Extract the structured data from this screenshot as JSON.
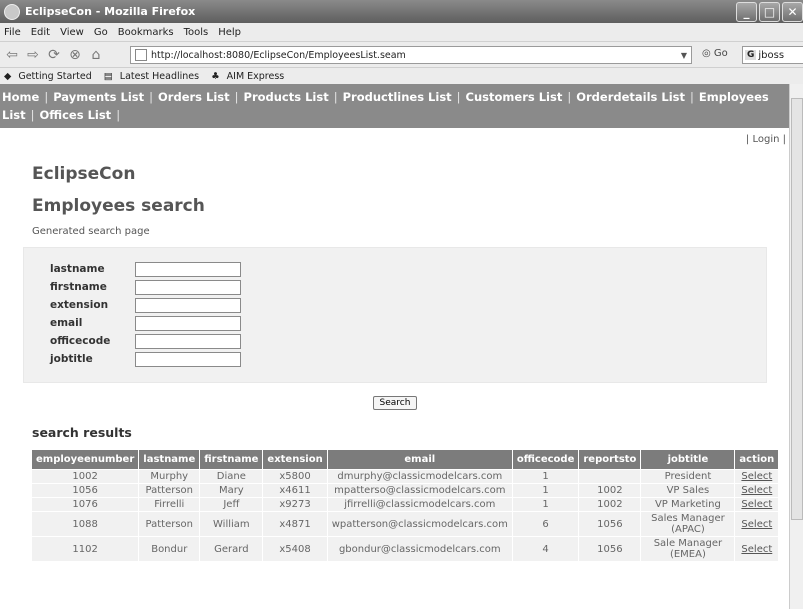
{
  "window": {
    "title": "EclipseCon - Mozilla Firefox"
  },
  "menubar": [
    "File",
    "Edit",
    "View",
    "Go",
    "Bookmarks",
    "Tools",
    "Help"
  ],
  "navbar": {
    "url": "http://localhost:8080/EclipseCon/EmployeesList.seam",
    "go_label": "Go",
    "search_value": "jboss",
    "search_engine": "G"
  },
  "bookmarks": [
    "Getting Started",
    "Latest Headlines",
    "AIM Express"
  ],
  "site_nav": [
    "Home",
    "Payments List",
    "Orders List",
    "Products List",
    "Productlines List",
    "Customers List",
    "Orderdetails List",
    "Employees List",
    "Offices List"
  ],
  "login_label": "Login",
  "page": {
    "app_title": "EclipseCon",
    "heading": "Employees search",
    "subtitle": "Generated search page",
    "fields": [
      "lastname",
      "firstname",
      "extension",
      "email",
      "officecode",
      "jobtitle"
    ],
    "search_button": "Search",
    "results_title": "search results"
  },
  "table": {
    "columns": [
      "employeenumber",
      "lastname",
      "firstname",
      "extension",
      "email",
      "officecode",
      "reportsto",
      "jobtitle",
      "action"
    ],
    "rows": [
      [
        "1002",
        "Murphy",
        "Diane",
        "x5800",
        "dmurphy@classicmodelcars.com",
        "1",
        "",
        "President",
        "Select"
      ],
      [
        "1056",
        "Patterson",
        "Mary",
        "x4611",
        "mpatterso@classicmodelcars.com",
        "1",
        "1002",
        "VP Sales",
        "Select"
      ],
      [
        "1076",
        "Firrelli",
        "Jeff",
        "x9273",
        "jfirrelli@classicmodelcars.com",
        "1",
        "1002",
        "VP Marketing",
        "Select"
      ],
      [
        "1088",
        "Patterson",
        "William",
        "x4871",
        "wpatterson@classicmodelcars.com",
        "6",
        "1056",
        "Sales Manager (APAC)",
        "Select"
      ],
      [
        "1102",
        "Bondur",
        "Gerard",
        "x5408",
        "gbondur@classicmodelcars.com",
        "4",
        "1056",
        "Sale Manager (EMEA)",
        "Select"
      ]
    ]
  }
}
